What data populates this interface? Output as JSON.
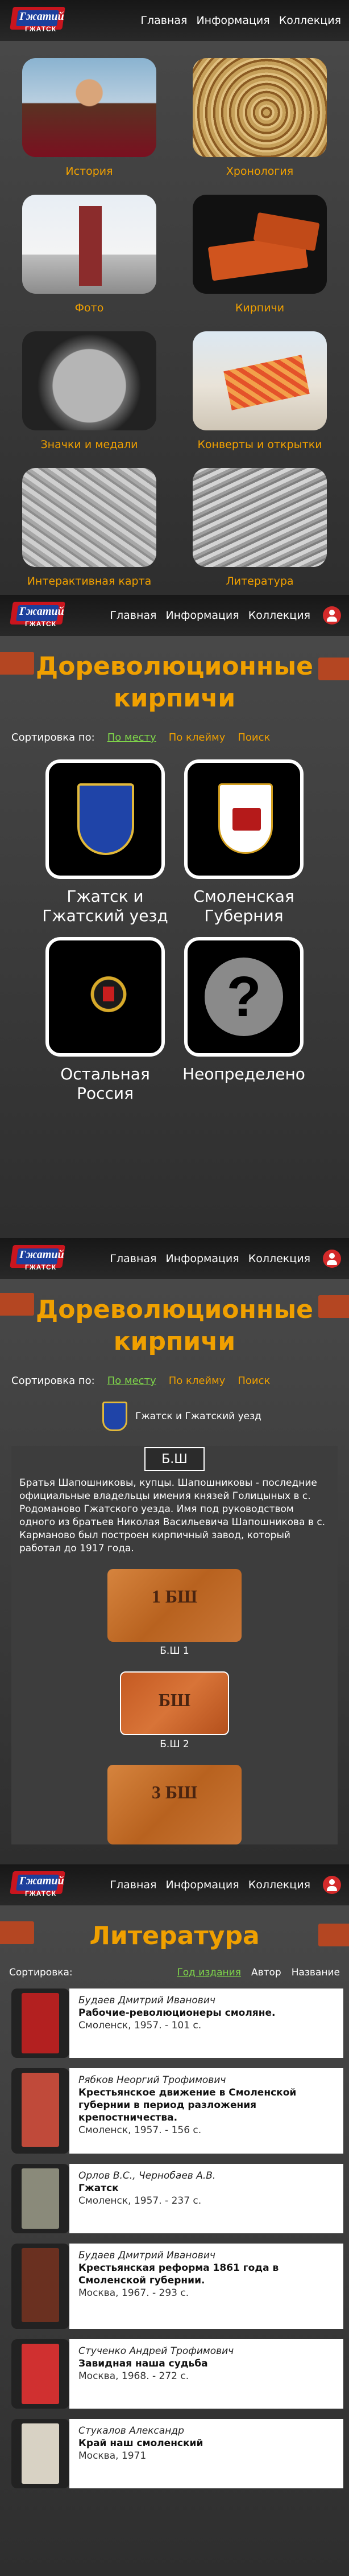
{
  "nav": {
    "logo": {
      "line1": "Гжатий",
      "line2": "ГЖАТСК"
    },
    "links": [
      "Главная",
      "Информация",
      "Коллекция"
    ]
  },
  "home": {
    "tiles": [
      {
        "label": "История",
        "image": "portrait-painting"
      },
      {
        "label": "Хронология",
        "image": "spiral-clock"
      },
      {
        "label": "Фото",
        "image": "church-photo"
      },
      {
        "label": "Кирпичи",
        "image": "bricks"
      },
      {
        "label": "Значки и медали",
        "image": "medal"
      },
      {
        "label": "Конверты и открытки",
        "image": "envelopes"
      },
      {
        "label": "Интерактивная карта",
        "image": "aerial-map"
      },
      {
        "label": "Литература",
        "image": "aerial-map"
      }
    ]
  },
  "bricks_page": {
    "title": "Дореволюционные кирпичи",
    "sort_label": "Сортировка по:",
    "sort_options": [
      "По месту",
      "По клейму",
      "Поиск"
    ],
    "active_sort": "По месту",
    "regions": [
      {
        "name": "Гжатск и Гжатский уезд",
        "icon": "gzhatsk-coat-of-arms-icon"
      },
      {
        "name": "Смоленская Губерния",
        "icon": "smolensk-coat-of-arms-icon"
      },
      {
        "name": "Остальная Россия",
        "icon": "russian-eagle-icon"
      },
      {
        "name": "Неопределено",
        "icon": "question-mark-icon"
      }
    ]
  },
  "bricks_detail": {
    "title": "Дореволюционные кирпичи",
    "sort_label": "Сортировка по:",
    "sort_options": [
      "По месту",
      "По клейму",
      "Поиск"
    ],
    "breadcrumb": "Гжатск и Гжатский уезд",
    "card": {
      "tag": "Б.Ш",
      "text": "Братья Шапошниковы, купцы. Шапошниковы - последние официальные владельцы имения князей Голицыных в с. Родомановo Гжатского уезда. Имя под руководством одного из братьев Николая Васильевича Шапошникова в с. Карманово был построен кирпичный завод, который работал до 1917 года.",
      "bricks": [
        {
          "stamp": "1 БШ",
          "caption": "Б.Ш 1"
        },
        {
          "stamp": "БШ",
          "caption": "Б.Ш 2"
        },
        {
          "stamp": "3 БШ",
          "caption": ""
        }
      ]
    }
  },
  "literature": {
    "title": "Литература",
    "sort_label": "Сортировка:",
    "sort_options": [
      "Год издания",
      "Автор",
      "Название"
    ],
    "active_sort": "Год издания",
    "books": [
      {
        "author": "Будаев Дмитрий Иванович",
        "title": "Рабочие-революционеры смоляне.",
        "pub": "Смоленск, 1957. - 101 с.",
        "cover": "#b32020"
      },
      {
        "author": "Рябков Неоргий Трофимович",
        "title": "Крестьянское движение в Смоленской губернии в период разложения крепостничества.",
        "pub": "Смоленск, 1957. - 156 с.",
        "cover": "#c04a3a"
      },
      {
        "author": "Орлов В.С., Чернобаев А.В.",
        "title": "Гжатск",
        "pub": "Смоленск, 1957. - 237 с.",
        "cover": "#8a8a7a"
      },
      {
        "author": "Будаев Дмитрий Иванович",
        "title": "Крестьянская реформа 1861 года в Смоленской губернии.",
        "pub": "Москва, 1967. - 293 с.",
        "cover": "#6a3020"
      },
      {
        "author": "Стученко Андрей Трофимович",
        "title": "Завидная наша судьба",
        "pub": "Москва, 1968. - 272 с.",
        "cover": "#d03030"
      },
      {
        "author": "Стукалов Александр",
        "title": "Край наш смоленский",
        "pub": "Москва, 1971",
        "cover": "#d8d2c4"
      }
    ]
  }
}
